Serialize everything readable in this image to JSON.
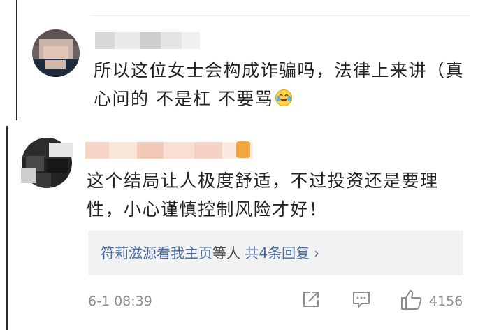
{
  "comments": [
    {
      "text": "所以这位女士会构成诈骗吗，法律上来讲（真心问的 不是杠  不要骂",
      "emoji": "laughing-crying-emoji"
    },
    {
      "text": "这个结局让人极度舒适，不过投资还是要理性，小心谨慎控制风险才好！",
      "replies": {
        "names": "符莉滋源看我主页",
        "mid": "等人",
        "count": "共4条回复",
        "chevron": "›"
      },
      "timestamp": "6-1 08:39",
      "likes": "4156"
    }
  ],
  "colors": {
    "link": "#4a6d9c",
    "meta": "#8e8e8e",
    "reply_bg": "#f2f2f2",
    "vip": "#f2a63d"
  },
  "icons": [
    "share-icon",
    "comment-icon",
    "like-icon"
  ]
}
